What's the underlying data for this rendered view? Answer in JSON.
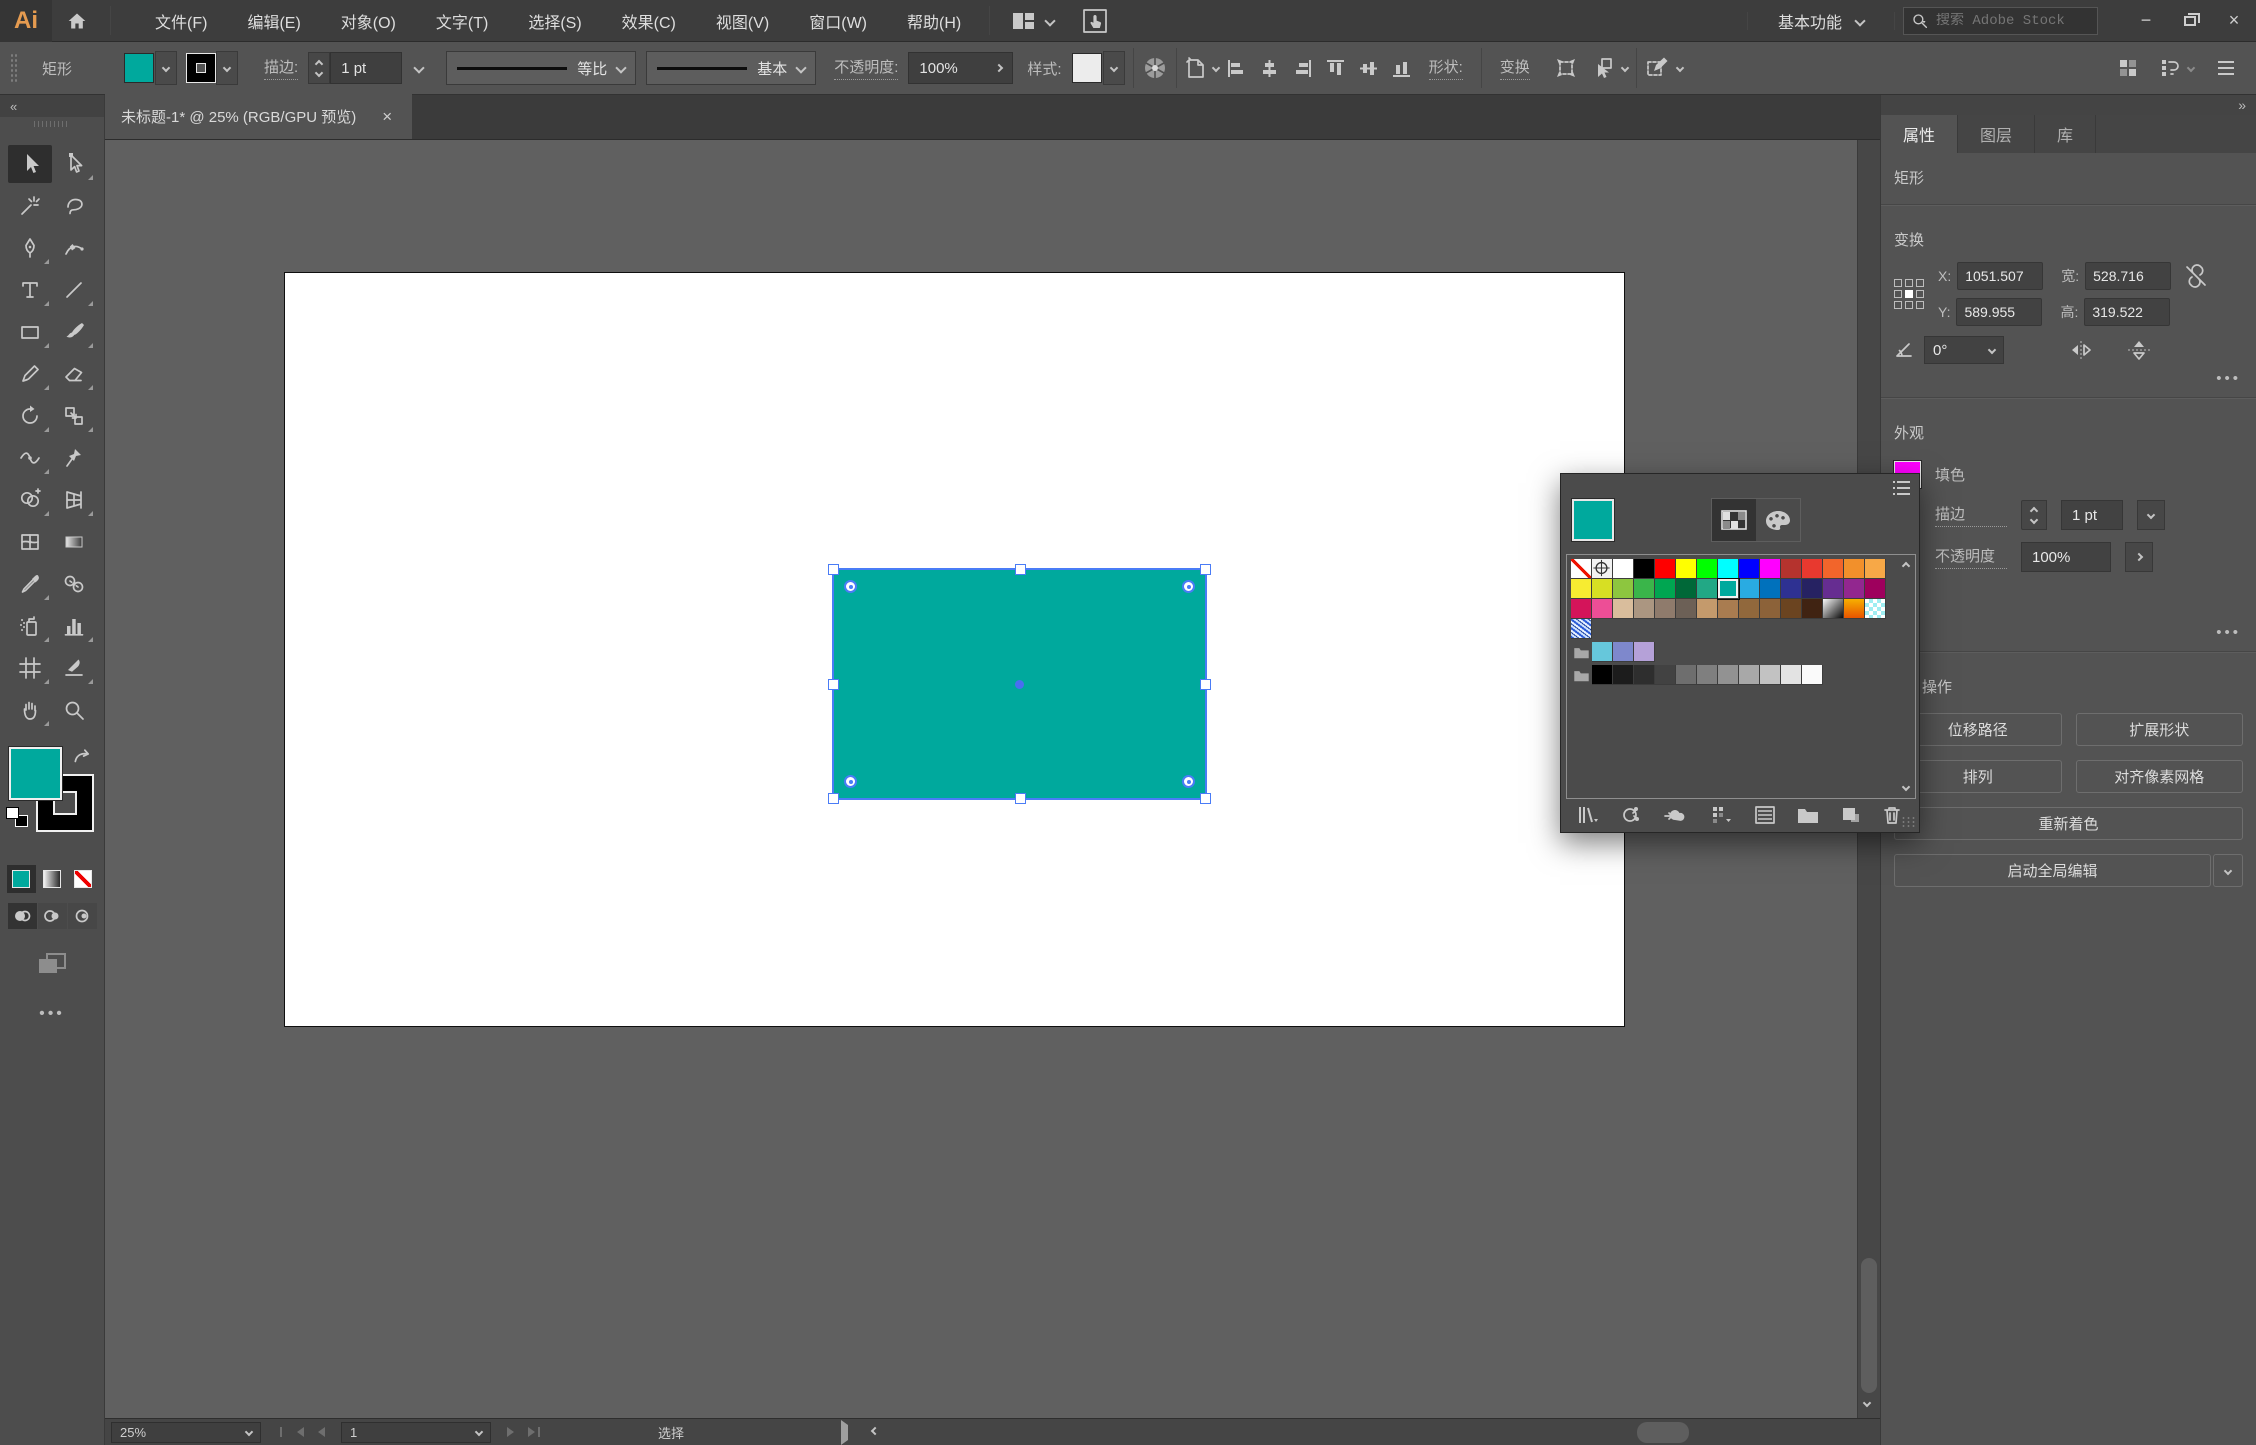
{
  "menubar": {
    "logo": "Ai",
    "menus": [
      "文件(F)",
      "编辑(E)",
      "对象(O)",
      "文字(T)",
      "选择(S)",
      "效果(C)",
      "视图(V)",
      "窗口(W)",
      "帮助(H)"
    ],
    "workspace": "基本功能",
    "search_placeholder": "搜索 Adobe Stock",
    "window": {
      "minimize": "−",
      "close": "×"
    }
  },
  "controlbar": {
    "selection_label": "矩形",
    "stroke_label": "描边:",
    "stroke_width": "1 pt",
    "variable_width_profile": "等比",
    "brush_definition": "基本",
    "opacity_label": "不透明度:",
    "opacity_value": "100%",
    "style_label": "样式:",
    "shape_label": "形状:",
    "transform_label": "变换"
  },
  "toolbar": {
    "collapse": "«",
    "tools": [
      "selection",
      "direct-selection",
      "magic-wand",
      "lasso",
      "pen",
      "curvature",
      "type",
      "line-segment",
      "rectangle",
      "paintbrush",
      "shaper",
      "eraser",
      "rotate",
      "scale",
      "width",
      "puppet-warp",
      "shape-builder",
      "perspective-grid",
      "mesh",
      "gradient",
      "eyedropper",
      "blend",
      "symbol-sprayer",
      "column-graph",
      "artboard",
      "slice",
      "hand",
      "zoom"
    ],
    "active_tool": "selection",
    "fill_color": "#00A99D",
    "stroke_color": "#000000",
    "more_label": "•••"
  },
  "document_tab": {
    "title": "未标题-1* @ 25% (RGB/GPU 预览)",
    "close": "×"
  },
  "canvas": {
    "shape_fill": "#00A99D",
    "selection_color": "#4A7CF6",
    "artboard_color": "#FFFFFF"
  },
  "properties_panel": {
    "collapse": "»",
    "tabs": [
      "属性",
      "图层",
      "库"
    ],
    "active_tab": "属性",
    "object_type": "矩形",
    "transform": {
      "title": "变换",
      "x_label": "X:",
      "x_value": "1051.507",
      "y_label": "Y:",
      "y_value": "589.955",
      "w_label": "宽:",
      "w_value": "528.716",
      "h_label": "高:",
      "h_value": "319.522",
      "angle_value": "0°",
      "more": "•••"
    },
    "appearance": {
      "title": "外观",
      "fill_label": "填色",
      "fill_color": "#FF00FF",
      "stroke_label": "描边",
      "stroke_value": "1 pt",
      "opacity_label": "不透明度",
      "opacity_value": "100%",
      "more": "•••"
    },
    "actions": {
      "title": "操作",
      "buttons": [
        "位移路径",
        "扩展形状",
        "排列",
        "对齐像素网格",
        "重新着色"
      ],
      "global_edit": "启动全局编辑"
    }
  },
  "swatches_panel": {
    "preview_color": "#00A99D",
    "grid": [
      [
        "none",
        "reg",
        "#FFFFFF",
        "#000000",
        "#FF0000",
        "#FFFF00",
        "#00FF00",
        "#00FFFF",
        "#0000FF",
        "#FF00FF",
        "#B5332E",
        "#E8392F",
        "#F2652B",
        "#F2902B",
        "#F7A847"
      ],
      [
        "#F7EC31",
        "#D7DF23",
        "#8DC63F",
        "#3AB54A",
        "#00A651",
        "#006838",
        "#22A885",
        "#00A99D",
        "#29ABE2",
        "#0071BC",
        "#2E3192",
        "#262262",
        "#662D91",
        "#92278F",
        "#9E005D"
      ],
      [
        "#D4145A",
        "#ED4E96",
        "#D9BD9C",
        "#AB9681",
        "#8F7B6C",
        "#6C6056",
        "#C49A6C",
        "#A97C50",
        "#91683C",
        "#8C6239",
        "#6B4420",
        "#402312",
        "grad-bw",
        "grad-orange",
        "checker"
      ],
      [
        "pattern"
      ]
    ],
    "selected_cell": {
      "row": 1,
      "col": 7
    },
    "groups": [
      [
        "#66C7DB",
        "#7E88CC",
        "#B5A1D8"
      ],
      [
        "#000000",
        "#1C1C1C",
        "#2E2E2E",
        "#424242",
        "#6E6E6E",
        "#7F7F7F",
        "#929292",
        "#A8A8A8",
        "#C2C2C2",
        "#E3E3E3",
        "#FAFAFA"
      ]
    ]
  },
  "statusbar": {
    "zoom": "25%",
    "artboard_number": "1",
    "status_text": "选择"
  }
}
